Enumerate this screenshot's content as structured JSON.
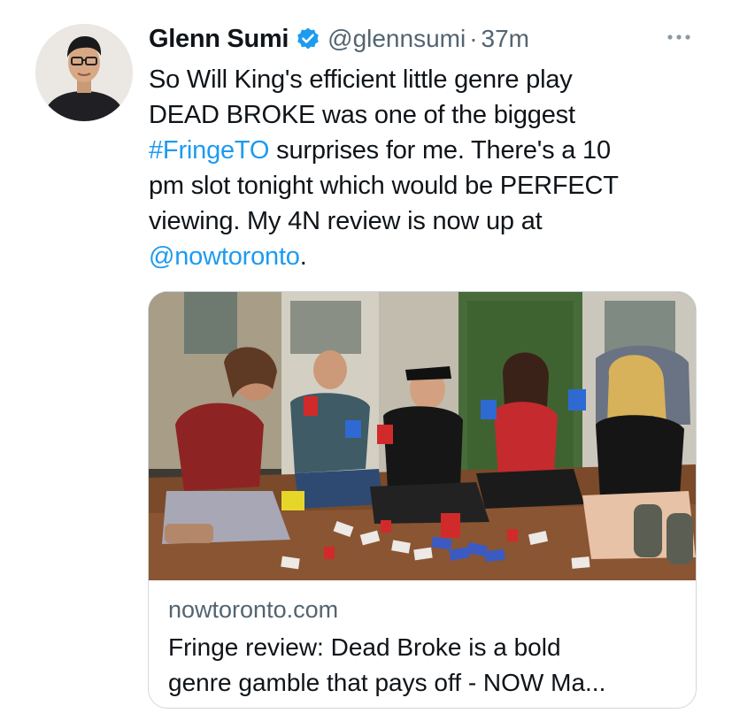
{
  "tweet": {
    "author_name": "Glenn Sumi",
    "handle": "@glennsumi",
    "separator": "·",
    "time": "37m",
    "body": {
      "line1": "So Will King's efficient little genre play",
      "line2": "DEAD BROKE was one of the biggest",
      "hashtag": "#FringeTO",
      "line3_rest": " surprises for me. There's a 10",
      "line4": "pm slot tonight which would be PERFECT",
      "line5": "viewing. My 4N review is now up at",
      "mention": "@nowtoronto",
      "mention_after": "."
    },
    "card": {
      "domain": "nowtoronto.com",
      "title_line1": "Fringe review: Dead Broke is a bold",
      "title_line2": "genre gamble that pays off - NOW Ma..."
    }
  },
  "icons": {
    "verified": "verified-badge-icon",
    "more": "more-options-icon"
  },
  "colors": {
    "link": "#1d9bf0",
    "secondary_text": "#536471",
    "primary_text": "#0f1419",
    "border": "#cfd9de"
  }
}
